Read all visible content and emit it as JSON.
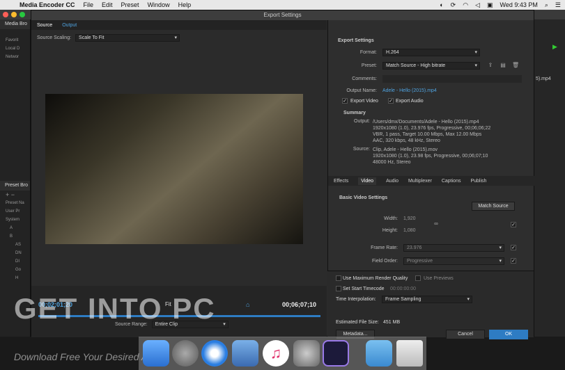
{
  "menubar": {
    "app": "Media Encoder CC",
    "items": [
      "File",
      "Edit",
      "Preset",
      "Window",
      "Help"
    ],
    "clock": "Wed 9:43 PM"
  },
  "bgpanel": {
    "media_browser": "Media Bro",
    "favorites": "Favorit",
    "local": "Local D",
    "network": "Networ",
    "preset_browser": "Preset Bro",
    "preset_name": "Preset Na",
    "user_presets": "User Pr",
    "system": "System",
    "a1": "A",
    "b1": "B",
    "as": "AS",
    "dn": "DN",
    "di": "DI",
    "go": "Go",
    "h": "H"
  },
  "rightstrip": {
    "filename": "5).mp4"
  },
  "dialog": {
    "title": "Export Settings",
    "tabs": [
      "Source",
      "Output"
    ],
    "source_scaling_label": "Source Scaling:",
    "source_scaling_value": "Scale To Fit",
    "timecode_in": "00;02;01;20",
    "fit": "Fit",
    "timecode_out": "00;06;07;10",
    "source_range_label": "Source Range:",
    "source_range_value": "Entire Clip"
  },
  "export_settings": {
    "header": "Export Settings",
    "format_label": "Format:",
    "format_value": "H.264",
    "preset_label": "Preset:",
    "preset_value": "Match Source - High bitrate",
    "comments_label": "Comments:",
    "output_name_label": "Output Name:",
    "output_name_value": "Adele - Hello (2015).mp4",
    "export_video": "Export Video",
    "export_audio": "Export Audio",
    "summary": "Summary",
    "output_label": "Output:",
    "output_lines": [
      "/Users/dmx/Documents/Adele - Hello (2015).mp4",
      "1920x1080 (1.0), 23.976 fps, Progressive, 00;06;06;22",
      "VBR, 1 pass, Target 10.00 Mbps, Max 12.00 Mbps",
      "AAC, 320 kbps, 48 kHz, Stereo"
    ],
    "source_label": "Source:",
    "source_lines": [
      "Clip, Adele - Hello (2015).mov",
      "1920x1080 (1.0), 23.98 fps, Progressive, 00;06;07;10",
      "48000 Hz, Stereo"
    ]
  },
  "tabs": [
    "Effects",
    "Video",
    "Audio",
    "Multiplexer",
    "Captions",
    "Publish"
  ],
  "video": {
    "header": "Basic Video Settings",
    "match_source": "Match Source",
    "width_label": "Width:",
    "width_value": "1,920",
    "height_label": "Height:",
    "height_value": "1,080",
    "frame_rate_label": "Frame Rate:",
    "frame_rate_value": "23.976",
    "field_order_label": "Field Order:",
    "field_order_value": "Progressive"
  },
  "bottom": {
    "use_max_quality": "Use Maximum Render Quality",
    "use_previews": "Use Previews",
    "set_start_timecode": "Set Start Timecode",
    "start_timecode": "00:00:00:00",
    "time_interp_label": "Time Interpolation:",
    "time_interp_value": "Frame Sampling",
    "file_size_label": "Estimated File Size:",
    "file_size_value": "451 MB",
    "metadata": "Metadata...",
    "cancel": "Cancel",
    "ok": "OK"
  },
  "watermark": {
    "main": "GET INTO PC",
    "sub": "Download Free Your Desired App"
  },
  "colors": {
    "accent": "#2e7cc3",
    "link": "#4fa3e0"
  }
}
